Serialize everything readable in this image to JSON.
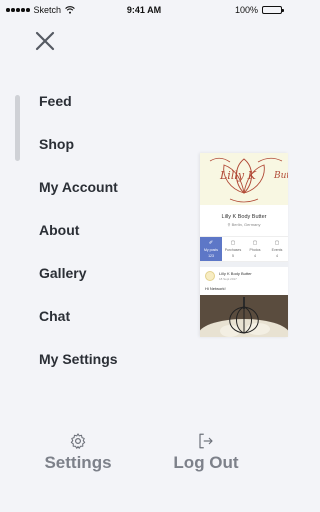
{
  "status_bar": {
    "carrier": "Sketch",
    "time": "9:41 AM",
    "battery": "100%"
  },
  "menu": {
    "items": [
      {
        "label": "Feed"
      },
      {
        "label": "Shop"
      },
      {
        "label": "My Account"
      },
      {
        "label": "About"
      },
      {
        "label": "Gallery"
      },
      {
        "label": "Chat"
      },
      {
        "label": "My Settings"
      }
    ]
  },
  "preview": {
    "cover_text_1": "Lilly K",
    "cover_text_2": "Butter",
    "profile_name": "Lilly K Body Butter",
    "location": "Berlin, Germany",
    "stats": [
      {
        "label": "My posts",
        "value": "123"
      },
      {
        "label": "Purchases",
        "value": "5"
      },
      {
        "label": "Photos",
        "value": "4"
      },
      {
        "label": "Events",
        "value": "4"
      }
    ],
    "post_author": "Lilly K Body Butter",
    "post_date": "18 Sept 2017",
    "post_text": "Hi Network!"
  },
  "footer": {
    "settings_label": "Settings",
    "logout_label": "Log Out"
  },
  "colors": {
    "background": "#f3f4f8",
    "menu_text": "#2b2f36",
    "footer_text": "#7d818a",
    "accent": "#5d77c7"
  },
  "icons": {
    "close": "close-icon",
    "settings": "gear-icon",
    "logout": "logout-icon"
  }
}
